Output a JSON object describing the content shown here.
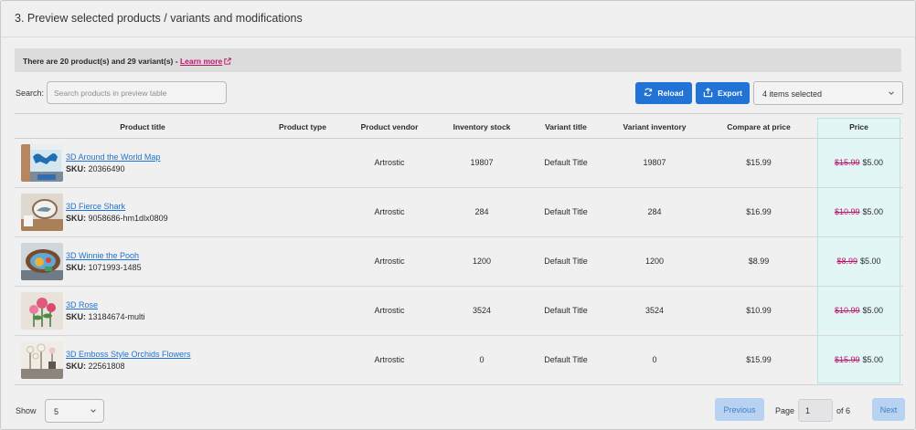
{
  "header": {
    "title": "3. Preview selected products / variants and modifications"
  },
  "notice": {
    "text": "There are 20 product(s) and 29 variant(s) - ",
    "link_label": "Learn more"
  },
  "search": {
    "label": "Search:",
    "placeholder": "Search products in preview table",
    "value": ""
  },
  "toolbar": {
    "reload_label": "Reload",
    "export_label": "Export",
    "selection_label": "4 items selected"
  },
  "table": {
    "columns": [
      "Product title",
      "Product type",
      "Product vendor",
      "Inventory stock",
      "Variant title",
      "Variant inventory",
      "Compare at price",
      "Price"
    ],
    "rows": [
      {
        "title": "3D Around the World Map",
        "sku_label": "SKU:",
        "sku": "20366490",
        "type": "",
        "vendor": "Artrostic",
        "stock": "19807",
        "variant_title": "Default Title",
        "variant_inventory": "19807",
        "compare_price": "$15.99",
        "old_price": "$15.99",
        "price": "$5.00"
      },
      {
        "title": "3D Fierce Shark",
        "sku_label": "SKU:",
        "sku": "9058686-hm1dlx0809",
        "type": "",
        "vendor": "Artrostic",
        "stock": "284",
        "variant_title": "Default Title",
        "variant_inventory": "284",
        "compare_price": "$16.99",
        "old_price": "$10.99",
        "price": "$5.00"
      },
      {
        "title": "3D Winnie the Pooh",
        "sku_label": "SKU:",
        "sku": "1071993-1485",
        "type": "",
        "vendor": "Artrostic",
        "stock": "1200",
        "variant_title": "Default Title",
        "variant_inventory": "1200",
        "compare_price": "$8.99",
        "old_price": "$8.99",
        "price": "$5.00"
      },
      {
        "title": "3D Rose",
        "sku_label": "SKU:",
        "sku": "13184674-multi",
        "type": "",
        "vendor": "Artrostic",
        "stock": "3524",
        "variant_title": "Default Title",
        "variant_inventory": "3524",
        "compare_price": "$10.99",
        "old_price": "$10.99",
        "price": "$5.00"
      },
      {
        "title": "3D Emboss Style Orchids Flowers",
        "sku_label": "SKU:",
        "sku": "22561808",
        "type": "",
        "vendor": "Artrostic",
        "stock": "0",
        "variant_title": "Default Title",
        "variant_inventory": "0",
        "compare_price": "$15.99",
        "old_price": "$15.99",
        "price": "$5.00"
      }
    ]
  },
  "pagination": {
    "show_label": "Show",
    "page_size": "5",
    "previous_label": "Previous",
    "page_label": "Page",
    "current_page": "1",
    "of_label": "of 6",
    "next_label": "Next"
  },
  "colors": {
    "primary": "#2273d6",
    "link": "#2073d4",
    "strike_price": "#c0136e",
    "price_highlight": "#e2f6f6"
  }
}
